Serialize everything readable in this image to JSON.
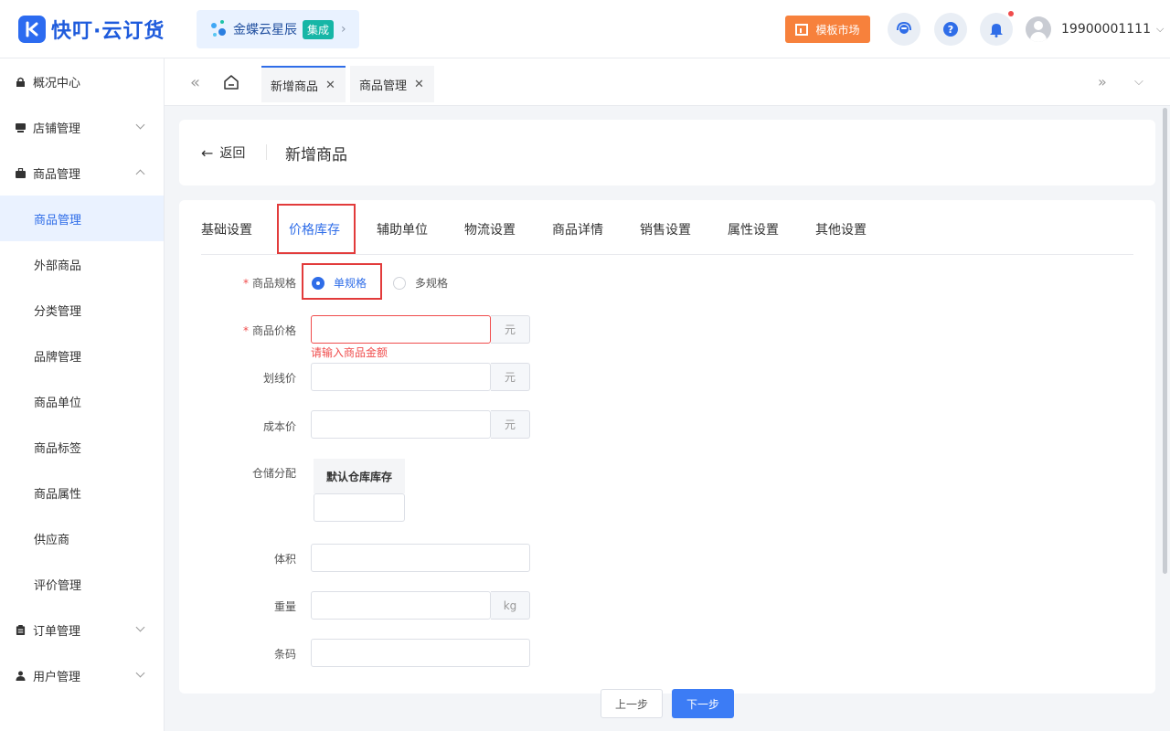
{
  "header": {
    "logo_text": "快叮·云订货",
    "integration_name": "金蝶云星辰",
    "integration_tag": "集成",
    "market_label": "模板市场",
    "username": "19900001111"
  },
  "sidebar": {
    "groups": [
      {
        "label": "概况中心"
      },
      {
        "label": "店铺管理"
      },
      {
        "label": "商品管理"
      },
      {
        "label": "订单管理"
      },
      {
        "label": "用户管理"
      }
    ],
    "items": [
      {
        "label": "商品管理"
      },
      {
        "label": "外部商品"
      },
      {
        "label": "分类管理"
      },
      {
        "label": "品牌管理"
      },
      {
        "label": "商品单位"
      },
      {
        "label": "商品标签"
      },
      {
        "label": "商品属性"
      },
      {
        "label": "供应商"
      },
      {
        "label": "评价管理"
      }
    ]
  },
  "tabbar": {
    "tabs": [
      {
        "label": "新增商品"
      },
      {
        "label": "商品管理"
      }
    ]
  },
  "page": {
    "back_label": "返回",
    "title": "新增商品"
  },
  "form_tabs": [
    "基础设置",
    "价格库存",
    "辅助单位",
    "物流设置",
    "商品详情",
    "销售设置",
    "属性设置",
    "其他设置"
  ],
  "form": {
    "spec_label": "商品规格",
    "spec_options": [
      "单规格",
      "多规格"
    ],
    "price_label": "商品价格",
    "price_error": "请输入商品金额",
    "price_unit": "元",
    "strike_price_label": "划线价",
    "strike_price_unit": "元",
    "cost_label": "成本价",
    "cost_unit": "元",
    "warehouse_label": "仓储分配",
    "warehouse_column": "默认仓库库存",
    "volume_label": "体积",
    "weight_label": "重量",
    "weight_unit": "kg",
    "barcode_label": "条码"
  },
  "footer": {
    "prev_label": "上一步",
    "next_label": "下一步"
  },
  "colors": {
    "accent": "#2f6de8",
    "error": "#f04c4c",
    "market": "#f7813c"
  }
}
